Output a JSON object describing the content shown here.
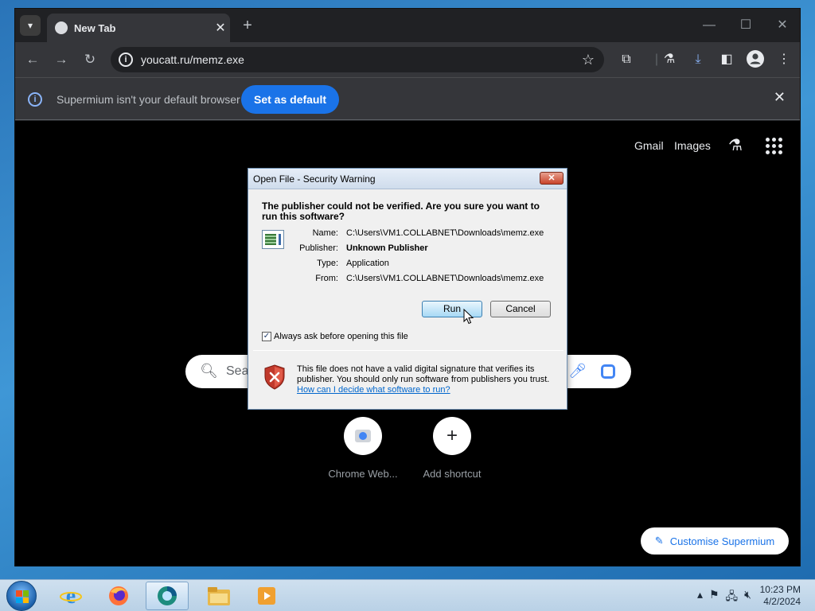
{
  "browser": {
    "tab_title": "New Tab",
    "url": "youcatt.ru/memz.exe",
    "infobar_message": "Supermium isn't your default browser",
    "set_default_label": "Set as default"
  },
  "newtab": {
    "gmail": "Gmail",
    "images": "Images",
    "search_placeholder": "Sea",
    "shortcuts": [
      {
        "label": "Chrome Web..."
      },
      {
        "label": "Add shortcut"
      }
    ],
    "customise_label": "Customise Supermium"
  },
  "dialog": {
    "title": "Open File - Security Warning",
    "question": "The publisher could not be verified.  Are you sure you want to run this software?",
    "name_label": "Name:",
    "name_value": "C:\\Users\\VM1.COLLABNET\\Downloads\\memz.exe",
    "publisher_label": "Publisher:",
    "publisher_value": "Unknown Publisher",
    "type_label": "Type:",
    "type_value": "Application",
    "from_label": "From:",
    "from_value": "C:\\Users\\VM1.COLLABNET\\Downloads\\memz.exe",
    "run_label": "Run",
    "cancel_label": "Cancel",
    "checkbox_label": "Always ask before opening this file",
    "checkbox_checked": true,
    "warning_text": "This file does not have a valid digital signature that verifies its publisher.  You should only run software from publishers you trust.",
    "help_link": "How can I decide what software to run?"
  },
  "taskbar": {
    "items": [
      "internet-explorer-icon",
      "firefox-icon",
      "supermium-icon",
      "file-explorer-icon",
      "media-player-icon"
    ],
    "time": "10:23 PM",
    "date": "4/2/2024"
  },
  "colors": {
    "accent": "#1a73e8",
    "browser_bg": "#202124",
    "toolbar_bg": "#35363a"
  }
}
